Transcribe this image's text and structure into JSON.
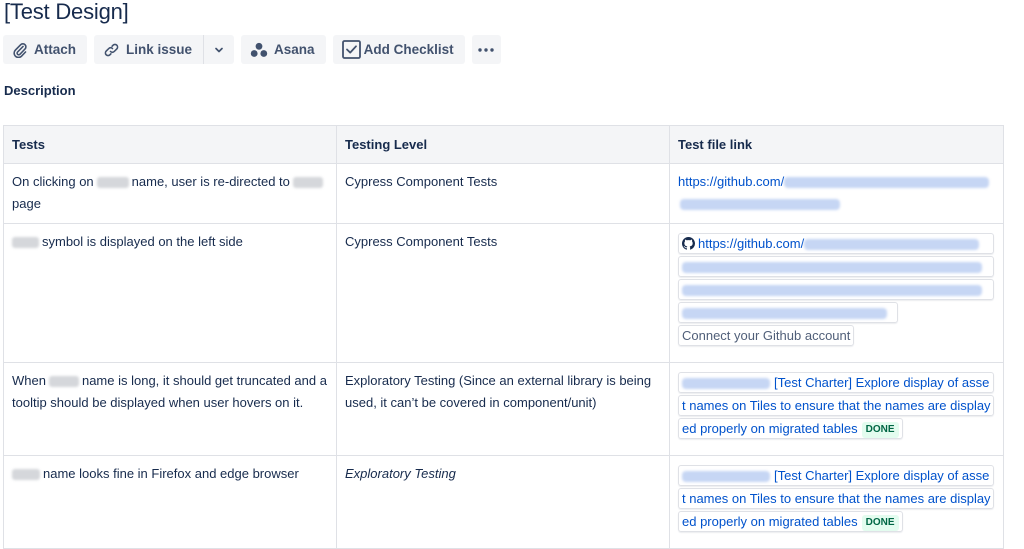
{
  "page": {
    "title": "[Test Design]"
  },
  "toolbar": {
    "attach_label": "Attach",
    "link_issue_label": "Link issue",
    "asana_label": "Asana",
    "add_checklist_label": "Add Checklist",
    "more_icon": "more-horizontal-icon"
  },
  "description": {
    "label": "Description",
    "table": {
      "headers": [
        "Tests",
        "Testing Level",
        "Test file link"
      ],
      "rows": [
        {
          "test_pre": "On clicking on",
          "test_mid": "name, user is re-directed to",
          "test_post": "page",
          "level": "Cypress Component Tests",
          "link_text": "https://github.com/"
        },
        {
          "test_post": "symbol is displayed on the left side",
          "level": "Cypress Component Tests",
          "link_text": "https://github.com/",
          "connect_label": "Connect your Github account"
        },
        {
          "test_pre": "When",
          "test_post": "name is long, it should get truncated and a tooltip should be displayed when user hovers on it.",
          "level": "Exploratory Testing (Since an external library is being used, it can’t be covered in component/unit)",
          "issue_line1": "[Test Charter] Explore display of asse",
          "issue_line2": "t names on Tiles to ensure that the names are display",
          "issue_line3": "ed properly on migrated tables",
          "status": "DONE"
        },
        {
          "test_post": "name looks fine in Firefox and edge browser",
          "level": "Exploratory Testing",
          "issue_line1": "[Test Charter] Explore display of asse",
          "issue_line2": "t names on Tiles to ensure that the names are display",
          "issue_line3": "ed properly on migrated tables",
          "status": "DONE"
        }
      ]
    }
  },
  "colors": {
    "text": "#172b4d",
    "link": "#0052cc",
    "button_bg": "#f4f5f7",
    "done_text": "#006644",
    "done_bg": "#e3fcef"
  }
}
